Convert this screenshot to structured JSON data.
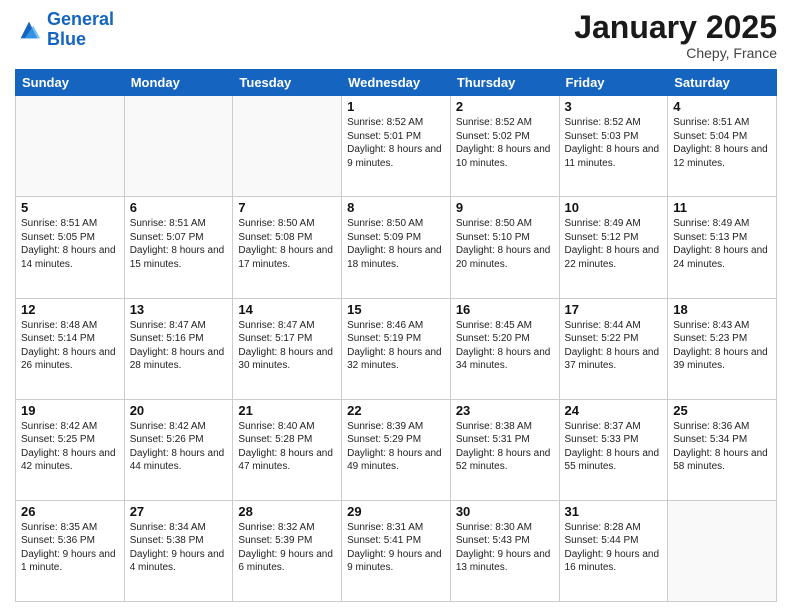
{
  "logo": {
    "line1": "General",
    "line2": "Blue"
  },
  "header": {
    "month": "January 2025",
    "location": "Chepy, France"
  },
  "weekdays": [
    "Sunday",
    "Monday",
    "Tuesday",
    "Wednesday",
    "Thursday",
    "Friday",
    "Saturday"
  ],
  "weeks": [
    [
      {
        "day": "",
        "sunrise": "",
        "sunset": "",
        "daylight": ""
      },
      {
        "day": "",
        "sunrise": "",
        "sunset": "",
        "daylight": ""
      },
      {
        "day": "",
        "sunrise": "",
        "sunset": "",
        "daylight": ""
      },
      {
        "day": "1",
        "sunrise": "Sunrise: 8:52 AM",
        "sunset": "Sunset: 5:01 PM",
        "daylight": "Daylight: 8 hours and 9 minutes."
      },
      {
        "day": "2",
        "sunrise": "Sunrise: 8:52 AM",
        "sunset": "Sunset: 5:02 PM",
        "daylight": "Daylight: 8 hours and 10 minutes."
      },
      {
        "day": "3",
        "sunrise": "Sunrise: 8:52 AM",
        "sunset": "Sunset: 5:03 PM",
        "daylight": "Daylight: 8 hours and 11 minutes."
      },
      {
        "day": "4",
        "sunrise": "Sunrise: 8:51 AM",
        "sunset": "Sunset: 5:04 PM",
        "daylight": "Daylight: 8 hours and 12 minutes."
      }
    ],
    [
      {
        "day": "5",
        "sunrise": "Sunrise: 8:51 AM",
        "sunset": "Sunset: 5:05 PM",
        "daylight": "Daylight: 8 hours and 14 minutes."
      },
      {
        "day": "6",
        "sunrise": "Sunrise: 8:51 AM",
        "sunset": "Sunset: 5:07 PM",
        "daylight": "Daylight: 8 hours and 15 minutes."
      },
      {
        "day": "7",
        "sunrise": "Sunrise: 8:50 AM",
        "sunset": "Sunset: 5:08 PM",
        "daylight": "Daylight: 8 hours and 17 minutes."
      },
      {
        "day": "8",
        "sunrise": "Sunrise: 8:50 AM",
        "sunset": "Sunset: 5:09 PM",
        "daylight": "Daylight: 8 hours and 18 minutes."
      },
      {
        "day": "9",
        "sunrise": "Sunrise: 8:50 AM",
        "sunset": "Sunset: 5:10 PM",
        "daylight": "Daylight: 8 hours and 20 minutes."
      },
      {
        "day": "10",
        "sunrise": "Sunrise: 8:49 AM",
        "sunset": "Sunset: 5:12 PM",
        "daylight": "Daylight: 8 hours and 22 minutes."
      },
      {
        "day": "11",
        "sunrise": "Sunrise: 8:49 AM",
        "sunset": "Sunset: 5:13 PM",
        "daylight": "Daylight: 8 hours and 24 minutes."
      }
    ],
    [
      {
        "day": "12",
        "sunrise": "Sunrise: 8:48 AM",
        "sunset": "Sunset: 5:14 PM",
        "daylight": "Daylight: 8 hours and 26 minutes."
      },
      {
        "day": "13",
        "sunrise": "Sunrise: 8:47 AM",
        "sunset": "Sunset: 5:16 PM",
        "daylight": "Daylight: 8 hours and 28 minutes."
      },
      {
        "day": "14",
        "sunrise": "Sunrise: 8:47 AM",
        "sunset": "Sunset: 5:17 PM",
        "daylight": "Daylight: 8 hours and 30 minutes."
      },
      {
        "day": "15",
        "sunrise": "Sunrise: 8:46 AM",
        "sunset": "Sunset: 5:19 PM",
        "daylight": "Daylight: 8 hours and 32 minutes."
      },
      {
        "day": "16",
        "sunrise": "Sunrise: 8:45 AM",
        "sunset": "Sunset: 5:20 PM",
        "daylight": "Daylight: 8 hours and 34 minutes."
      },
      {
        "day": "17",
        "sunrise": "Sunrise: 8:44 AM",
        "sunset": "Sunset: 5:22 PM",
        "daylight": "Daylight: 8 hours and 37 minutes."
      },
      {
        "day": "18",
        "sunrise": "Sunrise: 8:43 AM",
        "sunset": "Sunset: 5:23 PM",
        "daylight": "Daylight: 8 hours and 39 minutes."
      }
    ],
    [
      {
        "day": "19",
        "sunrise": "Sunrise: 8:42 AM",
        "sunset": "Sunset: 5:25 PM",
        "daylight": "Daylight: 8 hours and 42 minutes."
      },
      {
        "day": "20",
        "sunrise": "Sunrise: 8:42 AM",
        "sunset": "Sunset: 5:26 PM",
        "daylight": "Daylight: 8 hours and 44 minutes."
      },
      {
        "day": "21",
        "sunrise": "Sunrise: 8:40 AM",
        "sunset": "Sunset: 5:28 PM",
        "daylight": "Daylight: 8 hours and 47 minutes."
      },
      {
        "day": "22",
        "sunrise": "Sunrise: 8:39 AM",
        "sunset": "Sunset: 5:29 PM",
        "daylight": "Daylight: 8 hours and 49 minutes."
      },
      {
        "day": "23",
        "sunrise": "Sunrise: 8:38 AM",
        "sunset": "Sunset: 5:31 PM",
        "daylight": "Daylight: 8 hours and 52 minutes."
      },
      {
        "day": "24",
        "sunrise": "Sunrise: 8:37 AM",
        "sunset": "Sunset: 5:33 PM",
        "daylight": "Daylight: 8 hours and 55 minutes."
      },
      {
        "day": "25",
        "sunrise": "Sunrise: 8:36 AM",
        "sunset": "Sunset: 5:34 PM",
        "daylight": "Daylight: 8 hours and 58 minutes."
      }
    ],
    [
      {
        "day": "26",
        "sunrise": "Sunrise: 8:35 AM",
        "sunset": "Sunset: 5:36 PM",
        "daylight": "Daylight: 9 hours and 1 minute."
      },
      {
        "day": "27",
        "sunrise": "Sunrise: 8:34 AM",
        "sunset": "Sunset: 5:38 PM",
        "daylight": "Daylight: 9 hours and 4 minutes."
      },
      {
        "day": "28",
        "sunrise": "Sunrise: 8:32 AM",
        "sunset": "Sunset: 5:39 PM",
        "daylight": "Daylight: 9 hours and 6 minutes."
      },
      {
        "day": "29",
        "sunrise": "Sunrise: 8:31 AM",
        "sunset": "Sunset: 5:41 PM",
        "daylight": "Daylight: 9 hours and 9 minutes."
      },
      {
        "day": "30",
        "sunrise": "Sunrise: 8:30 AM",
        "sunset": "Sunset: 5:43 PM",
        "daylight": "Daylight: 9 hours and 13 minutes."
      },
      {
        "day": "31",
        "sunrise": "Sunrise: 8:28 AM",
        "sunset": "Sunset: 5:44 PM",
        "daylight": "Daylight: 9 hours and 16 minutes."
      },
      {
        "day": "",
        "sunrise": "",
        "sunset": "",
        "daylight": ""
      }
    ]
  ]
}
